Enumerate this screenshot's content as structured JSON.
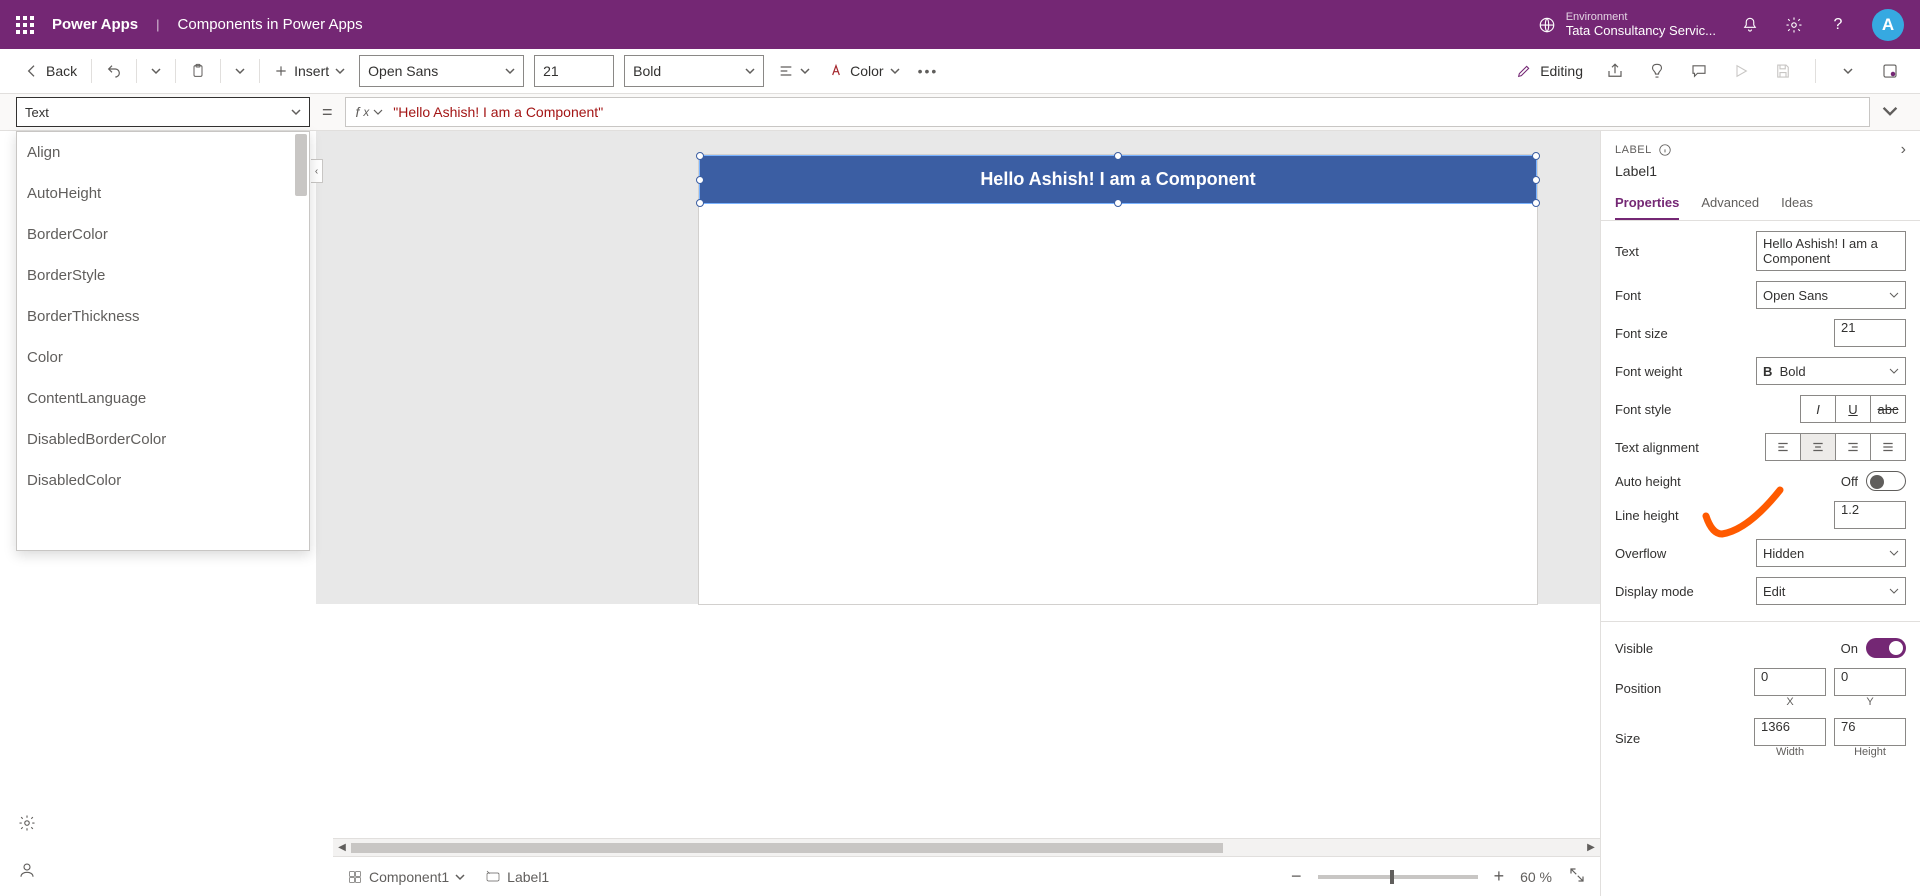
{
  "header": {
    "brand": "Power Apps",
    "app_title": "Components in Power Apps",
    "env_label": "Environment",
    "env_name": "Tata Consultancy Servic...",
    "avatar_initial": "A"
  },
  "cmdbar": {
    "back": "Back",
    "insert": "Insert",
    "font": "Open Sans",
    "font_size": "21",
    "font_weight": "Bold",
    "color": "Color",
    "editing": "Editing"
  },
  "formula": {
    "property": "Text",
    "fx": "fx",
    "value": "\"Hello Ashish! I am a Component\""
  },
  "propDropdown": [
    "Align",
    "AutoHeight",
    "BorderColor",
    "BorderStyle",
    "BorderThickness",
    "Color",
    "ContentLanguage",
    "DisabledBorderColor",
    "DisabledColor"
  ],
  "canvas": {
    "label_text": "Hello Ashish! I am a Component"
  },
  "status": {
    "component": "Component1",
    "breadcrumb_child": "Label1",
    "zoom": "60 %"
  },
  "props": {
    "type": "LABEL",
    "name": "Label1",
    "tabs": {
      "properties": "Properties",
      "advanced": "Advanced",
      "ideas": "Ideas"
    },
    "text_label": "Text",
    "text_value": "Hello Ashish! I am a Component",
    "font_label": "Font",
    "font_value": "Open Sans",
    "font_size_label": "Font size",
    "font_size_value": "21",
    "font_weight_label": "Font weight",
    "font_weight_value": "Bold",
    "font_style_label": "Font style",
    "text_align_label": "Text alignment",
    "auto_height_label": "Auto height",
    "auto_height_state": "Off",
    "line_height_label": "Line height",
    "line_height_value": "1.2",
    "overflow_label": "Overflow",
    "overflow_value": "Hidden",
    "display_mode_label": "Display mode",
    "display_mode_value": "Edit",
    "visible_label": "Visible",
    "visible_state": "On",
    "position_label": "Position",
    "pos_x": "0",
    "pos_y": "0",
    "pos_x_label": "X",
    "pos_y_label": "Y",
    "size_label": "Size",
    "width": "1366",
    "height": "76",
    "width_label": "Width",
    "height_label": "Height"
  }
}
